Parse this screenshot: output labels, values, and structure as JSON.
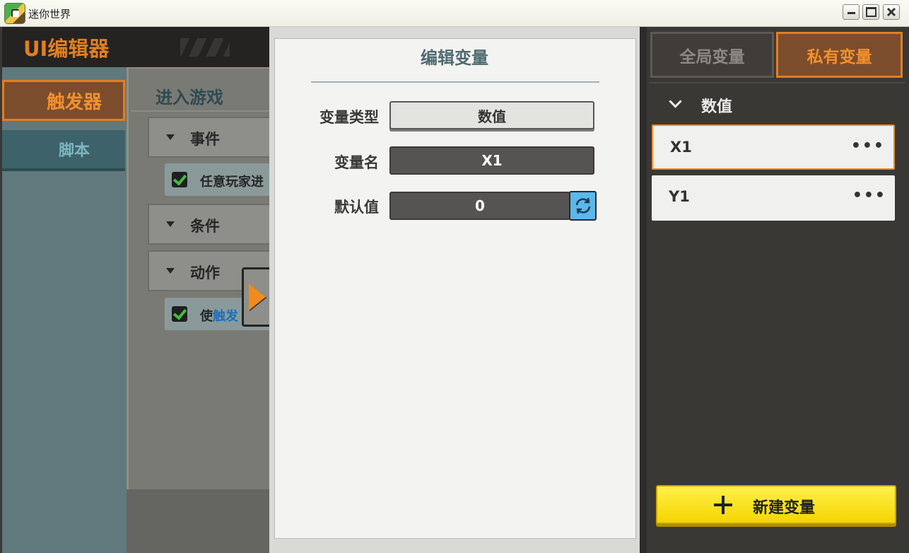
{
  "window": {
    "title": "迷你世界"
  },
  "editor": {
    "title": "UI编辑器",
    "tabs": [
      {
        "label": "触发器"
      },
      {
        "label": "脚本"
      }
    ],
    "section_title": "进入游戏",
    "groups": [
      {
        "label": "事件"
      },
      {
        "label": "条件"
      },
      {
        "label": "动作"
      }
    ],
    "event_item": "任意玩家进",
    "action_item_prefix": "使",
    "action_item_link": "触发"
  },
  "dialog": {
    "title": "编辑变量",
    "fields": {
      "type_label": "变量类型",
      "type_value": "数值",
      "name_label": "变量名",
      "name_value": "X1",
      "default_label": "默认值",
      "default_value": "0"
    }
  },
  "right_panel": {
    "tabs": {
      "global": "全局变量",
      "private": "私有变量"
    },
    "category": "数值",
    "variables": [
      {
        "name": "X1",
        "selected": true
      },
      {
        "name": "Y1",
        "selected": false
      }
    ],
    "more_glyph": "•••",
    "new_button": "新建变量"
  },
  "colors": {
    "accent_orange": "#e07f22",
    "new_button_yellow": "#f5d500",
    "refresh_blue": "#5ab8ea"
  }
}
